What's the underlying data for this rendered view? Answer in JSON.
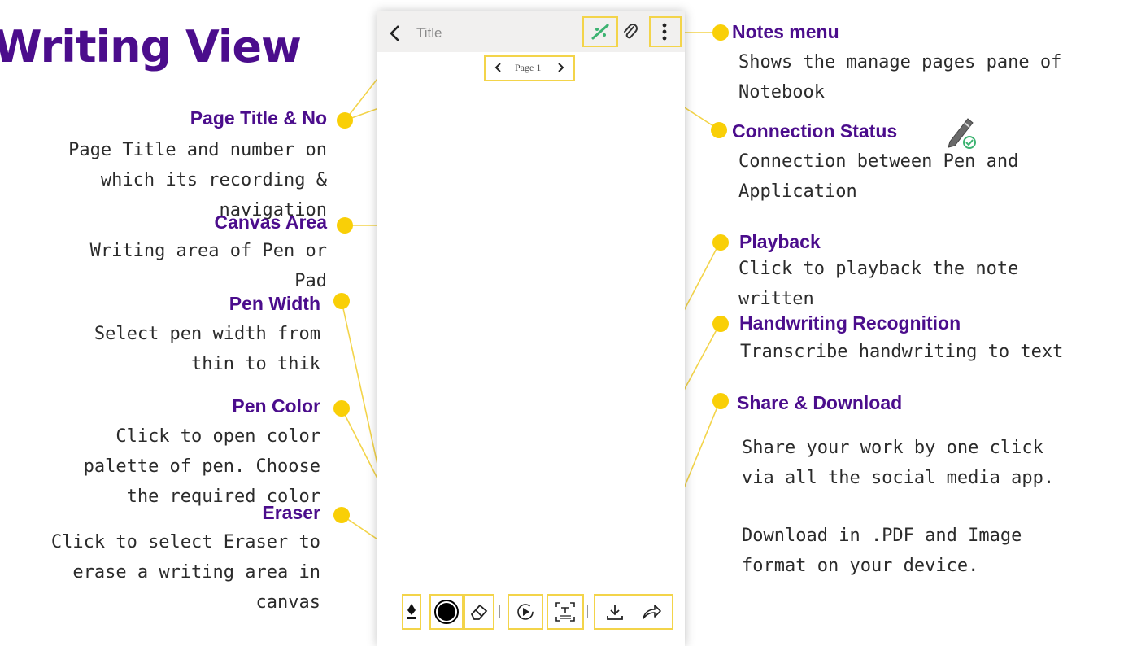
{
  "heading": "Writing View",
  "phone": {
    "title_placeholder": "Title",
    "page_label": "Page 1",
    "icons": {
      "back": "chevron-left-icon",
      "connection": "pen-connection-icon",
      "attach": "paperclip-icon",
      "menu": "more-vertical-icon",
      "pen_width": "fountain-pen-icon",
      "pen_color": "color-dot-icon",
      "eraser": "eraser-icon",
      "playback": "playback-icon",
      "recognition": "text-recognition-icon",
      "download": "download-icon",
      "share": "share-icon"
    }
  },
  "callouts": {
    "page_title": {
      "title": "Page Title & No",
      "desc": "Page Title and number on\nwhich its recording &\nnavigation"
    },
    "canvas": {
      "title": "Canvas Area",
      "desc": "Writing area of Pen or\nPad"
    },
    "pen_width": {
      "title": "Pen Width",
      "desc": "Select pen width from\nthin to thik"
    },
    "pen_color": {
      "title": "Pen Color",
      "desc": "Click to open color\npalette of pen. Choose\nthe required color"
    },
    "eraser": {
      "title": "Eraser",
      "desc": "Click to select Eraser to\nerase a writing area in\ncanvas"
    },
    "notes_menu": {
      "title": "Notes menu",
      "desc": "Shows the manage pages pane of\nNotebook"
    },
    "connection": {
      "title": "Connection Status",
      "desc": "Connection between Pen and\nApplication"
    },
    "playback": {
      "title": "Playback",
      "desc": "Click  to  playback  the  note\nwritten"
    },
    "recognition": {
      "title": "Handwriting Recognition",
      "desc": "Transcribe handwriting to text"
    },
    "share": {
      "title": "Share & Download",
      "desc": "Share  your  work  by  one  click\nvia all the social media app.",
      "desc2": "Download  in  .PDF  and  Image\nformat on your device."
    }
  },
  "colors": {
    "accent": "#4b0d8c",
    "callout": "#f9cf07",
    "connected": "#3cb371"
  }
}
